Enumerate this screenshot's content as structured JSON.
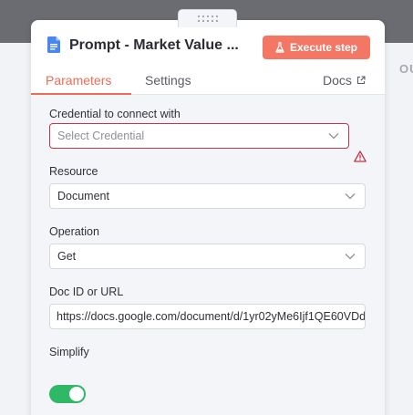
{
  "sidebar_peek": {
    "label": "OU"
  },
  "node": {
    "title": "Prompt - Market Value ...",
    "execute_label": "Execute step",
    "icon": "google-docs-icon"
  },
  "tabs": {
    "items": [
      {
        "label": "Parameters",
        "active": true
      },
      {
        "label": "Settings",
        "active": false
      }
    ],
    "docs_label": "Docs"
  },
  "params": {
    "credential": {
      "label": "Credential to connect with",
      "placeholder": "Select Credential",
      "state": "error"
    },
    "resource": {
      "label": "Resource",
      "value": "Document"
    },
    "operation": {
      "label": "Operation",
      "value": "Get"
    },
    "doc_id": {
      "label": "Doc ID or URL",
      "value": "https://docs.google.com/document/d/1yr02yMe6Ijf1QE60VDd"
    },
    "simplify": {
      "label": "Simplify",
      "enabled": true
    }
  },
  "colors": {
    "accent": "#ee6b59",
    "execute_button": "#f47766",
    "error": "#c4344a",
    "toggle_on": "#2fb865",
    "doc_icon": "#4a86f0"
  }
}
